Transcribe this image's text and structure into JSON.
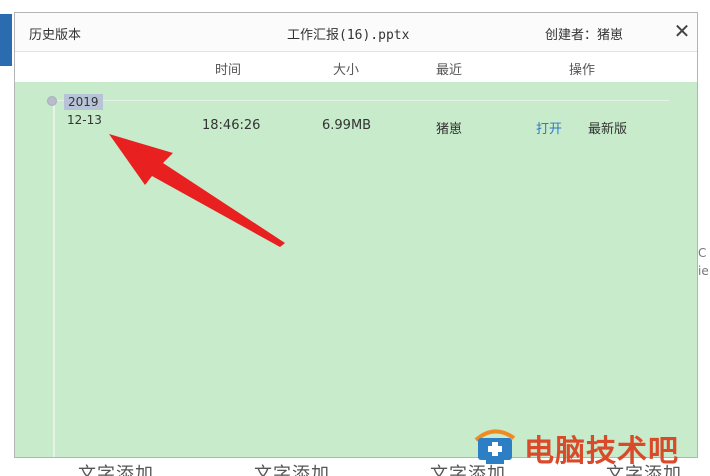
{
  "dialog": {
    "title": "历史版本",
    "file_name": "工作汇报(16).pptx",
    "creator": "创建者：猪崽",
    "close_label": "✕"
  },
  "columns": {
    "time": "时间",
    "size": "大小",
    "recent": "最近",
    "actions": "操作"
  },
  "versions": [
    {
      "year": "2019",
      "date": "12-13",
      "time": "18:46:26",
      "size": "6.99MB",
      "recent": "猪崽",
      "open_label": "打开",
      "status": "最新版"
    }
  ],
  "background": {
    "bottom_labels": [
      "文字添加",
      "文字添加",
      "文字添加",
      "文字添加"
    ],
    "right_fragment": [
      "C",
      "ie"
    ]
  },
  "watermark": {
    "text": "电脑技术吧"
  },
  "colors": {
    "dialog_body": "#c7ebcb",
    "link": "#2e78c7",
    "arrow": "#e82020",
    "watermark": "#d94a2a"
  }
}
